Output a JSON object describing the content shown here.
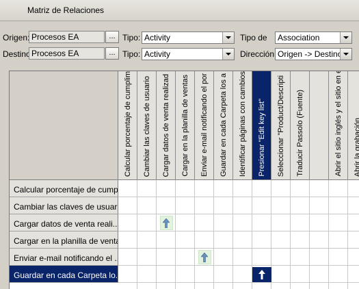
{
  "window": {
    "title": "Matriz de Relaciones"
  },
  "filters": {
    "origen_label": "Origen:",
    "origen_value": "Procesos EA",
    "destino_label": "Destino",
    "destino_value": "Procesos EA",
    "browse_label": "...",
    "tipo_label_1": "Tipo:",
    "tipo_value_1": "Activity",
    "tipo_label_2": "Tipo:",
    "tipo_value_2": "Activity",
    "tipo_de_label": "Tipo de",
    "tipo_de_value": "Association",
    "direccion_label": "Dirección:",
    "direccion_value": "Origen -> Destino"
  },
  "matrix": {
    "columns": [
      "Calcular porcentaje de cumplim",
      "Cambiar las claves de usuario",
      "Cargar datos de venta realizad",
      "Cargar en la planilla de ventas",
      "Enviar e-mail notificando el por",
      "Guardar en cada Carpeta los a",
      "Identificar páginas con cambios",
      "Presionar \"Edit key list\"",
      "Seleccionar \"Product/Descripti",
      "Traducir Passolo (Fuente)",
      "",
      "Abrir el sitio inglés y el sitio en e",
      "Abrir la grabación"
    ],
    "selected_column": 7,
    "rows": [
      "Calcular porcentaje de cump...",
      "Cambiar las claves de usuari...",
      "Cargar datos de venta reali...",
      "Cargar en la planilla de ventas",
      "Enviar e-mail notificando el ...",
      "Guardar en cada Carpeta lo..."
    ],
    "selected_row": 5,
    "relations": [
      {
        "row": 2,
        "col": 2,
        "icon": "up-arrow-icon",
        "style": "light"
      },
      {
        "row": 4,
        "col": 4,
        "icon": "up-arrow-icon",
        "style": "light"
      },
      {
        "row": 5,
        "col": 7,
        "icon": "up-arrow-icon",
        "style": "dark"
      }
    ],
    "colors": {
      "selection": "#0a246a",
      "relation_bg": "#e3f2df",
      "arrow_light": "#6a8fb8"
    }
  }
}
